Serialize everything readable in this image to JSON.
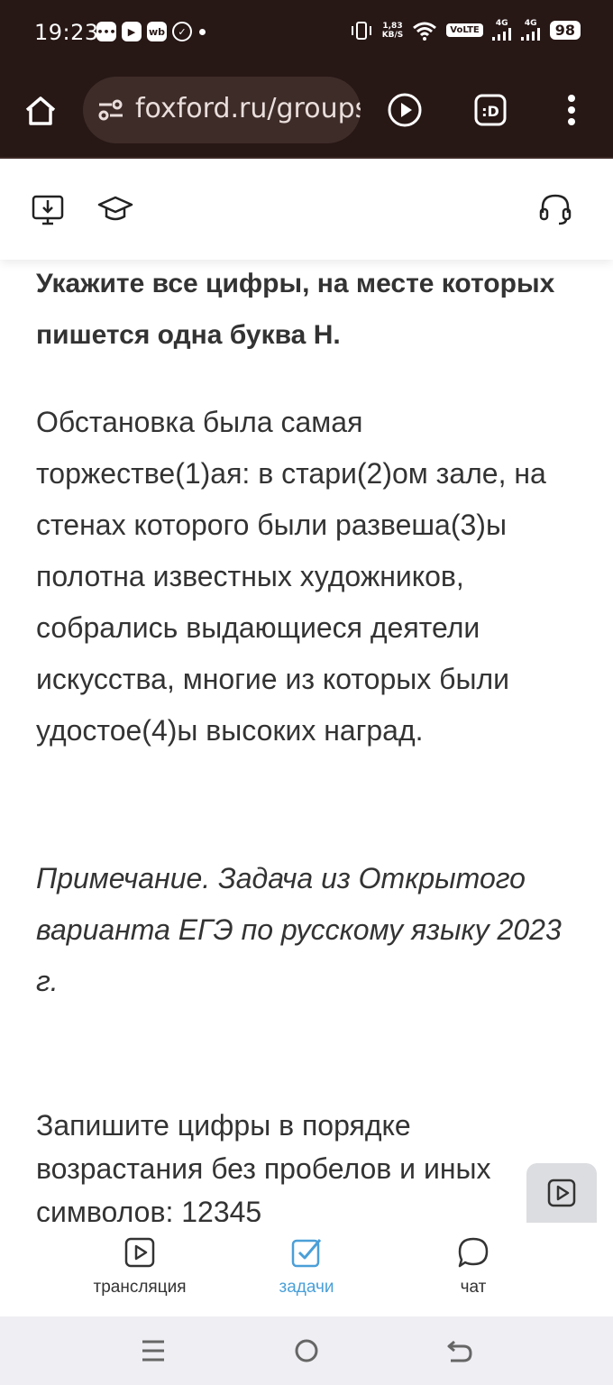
{
  "status_bar": {
    "time": "19:23",
    "app_badge_wb": "wb",
    "net_speed_value": "1,83",
    "net_speed_unit": "KB/S",
    "volte": "VoLTE",
    "sim1_label": "4G",
    "sim2_label": "4G",
    "battery": "98"
  },
  "browser": {
    "url": "foxford.ru/groups",
    "icons": [
      "home-icon",
      "site-settings-icon",
      "play-icon",
      "d-tab-icon",
      "more-vert-icon"
    ]
  },
  "app_header": {
    "icons": [
      "download-monitor-icon",
      "graduation-cap-icon",
      "headset-icon"
    ]
  },
  "task": {
    "title": "Укажите все цифры, на месте которых пишется одна буква Н.",
    "body": "Обстановка была самая торжестве(1)ая: в стари(2)ом зале, на стенах которого были развеша(3)ы полотна известных художников, собрались выдающиеся деятели искусства, многие из которых были удостое(4)ы высоких наград.",
    "note": "Примечание. Задача из Открытого варианта ЕГЭ по русскому языку 2023 г.",
    "instruction": "Запишите цифры в порядке возрастания без пробелов и иных символов: 12345"
  },
  "bottom_nav": {
    "items": [
      {
        "label": "трансляция",
        "icon": "video-play-icon",
        "active": false
      },
      {
        "label": "задачи",
        "icon": "checkbox-icon",
        "active": true
      },
      {
        "label": "чат",
        "icon": "chat-bubble-icon",
        "active": false
      }
    ],
    "active_color": "#4a9fd8"
  },
  "colors": {
    "browser_bg": "#271715",
    "text": "#333333"
  }
}
